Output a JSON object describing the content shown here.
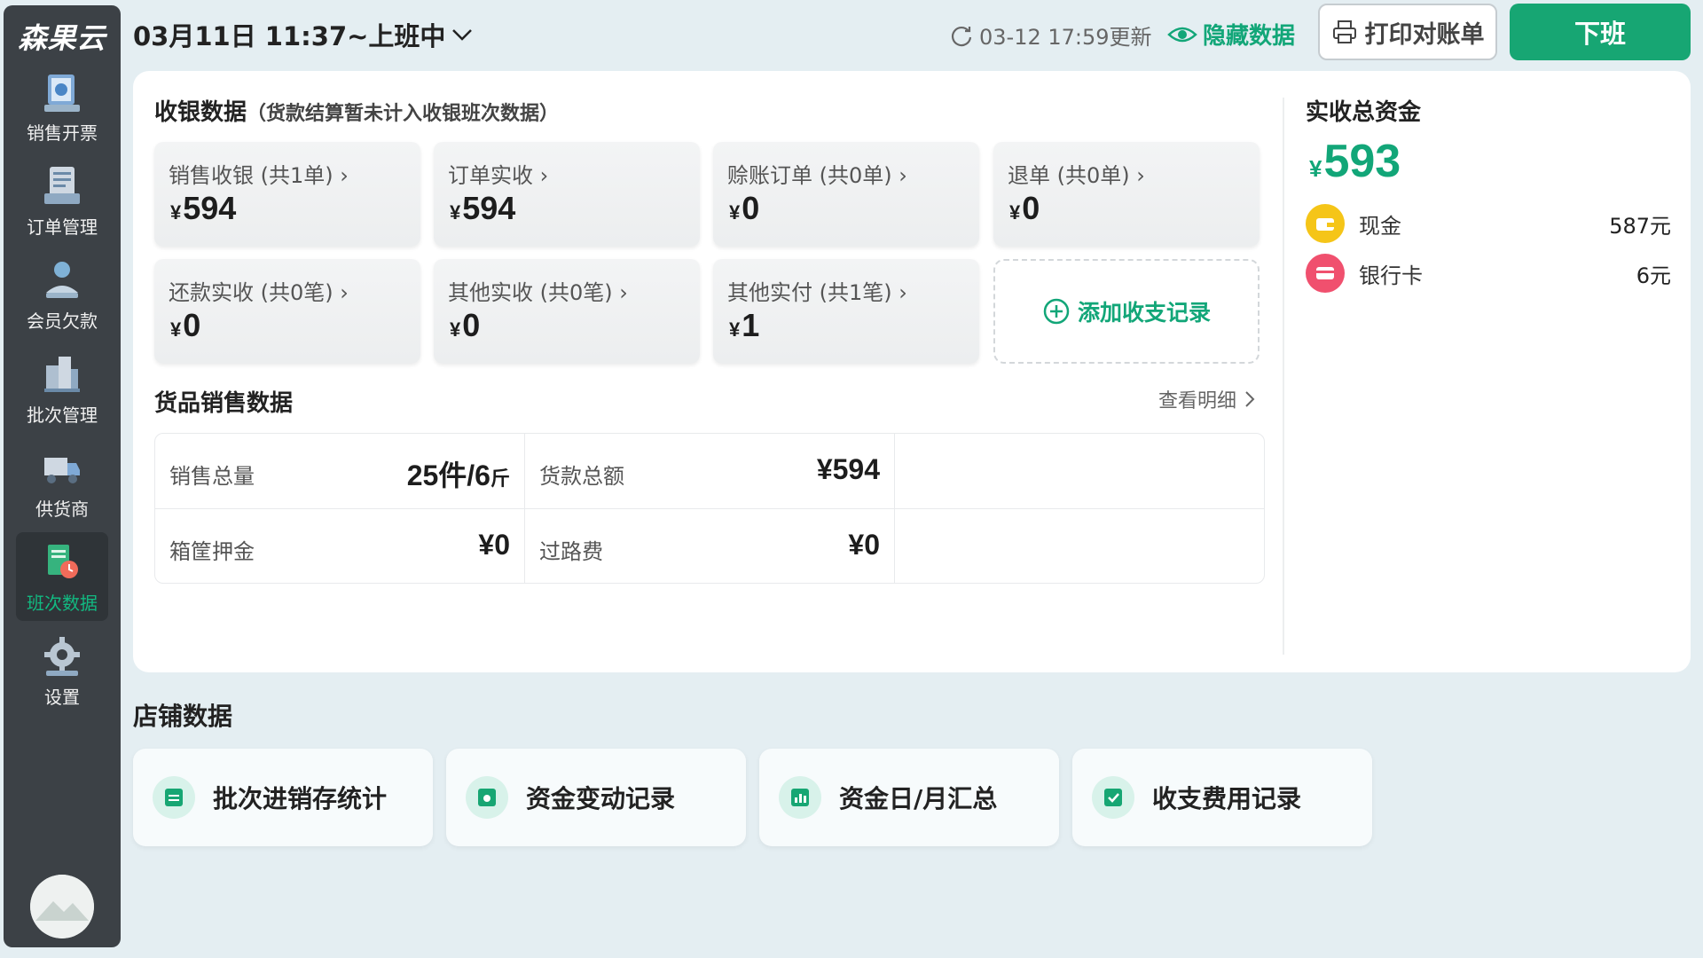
{
  "app": {
    "brand": "森果云"
  },
  "sidebar": {
    "items": [
      {
        "label": "销售开票",
        "icon": "receipt-icon"
      },
      {
        "label": "订单管理",
        "icon": "order-list-icon"
      },
      {
        "label": "会员欠款",
        "icon": "member-debt-icon"
      },
      {
        "label": "批次管理",
        "icon": "batch-buildings-icon"
      },
      {
        "label": "供货商",
        "icon": "supplier-truck-icon"
      },
      {
        "label": "班次数据",
        "icon": "shift-data-icon",
        "active": true
      },
      {
        "label": "设置",
        "icon": "gear-icon"
      }
    ]
  },
  "header": {
    "shift_title": "03月11日 11:37~上班中",
    "update_text": "03-12 17:59更新",
    "hide_data_label": "隐藏数据",
    "print_label": "打印对账单",
    "offduty_label": "下班"
  },
  "cashier": {
    "title": "收银数据",
    "note": "（货款结算暂未计入收银班次数据）",
    "cards": [
      {
        "label": "销售收银 (共1单)",
        "value": "594"
      },
      {
        "label": "订单实收",
        "value": "594"
      },
      {
        "label": "赊账订单 (共0单)",
        "value": "0"
      },
      {
        "label": "退单 (共0单)",
        "value": "0"
      },
      {
        "label": "还款实收 (共0笔)",
        "value": "0"
      },
      {
        "label": "其他实收 (共0笔)",
        "value": "0"
      },
      {
        "label": "其他实付 (共1笔)",
        "value": "1"
      }
    ],
    "add_label": "添加收支记录",
    "currency": "¥"
  },
  "goods": {
    "title": "货品销售数据",
    "detail_link": "查看明细",
    "rows": [
      {
        "label": "销售总量",
        "value": "25件/6",
        "unit": "斤"
      },
      {
        "label": "货款总额",
        "value": "¥594"
      },
      {
        "label": "箱筐押金",
        "value": "¥0"
      },
      {
        "label": "过路费",
        "value": "¥0"
      }
    ]
  },
  "total": {
    "title": "实收总资金",
    "currency": "¥",
    "amount": "593",
    "methods": [
      {
        "name": "现金",
        "amount": "587元",
        "color": "#f5c518"
      },
      {
        "name": "银行卡",
        "amount": "6元",
        "color": "#f0506e"
      }
    ]
  },
  "store": {
    "title": "店铺数据",
    "cards": [
      {
        "label": "批次进销存统计"
      },
      {
        "label": "资金变动记录"
      },
      {
        "label": "资金日/月汇总"
      },
      {
        "label": "收支费用记录"
      }
    ]
  },
  "colors": {
    "accent": "#17a673",
    "sidebar_bg": "#3c4146",
    "page_bg": "#e4eef2"
  }
}
